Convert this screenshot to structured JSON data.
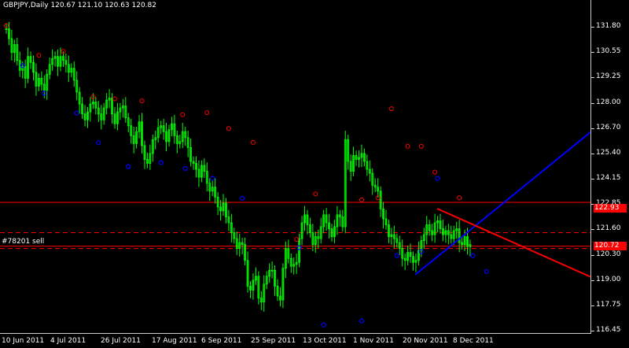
{
  "header": {
    "symbol_line": "GBPJPY,Daily  120.67 121.10 120.63 120.82"
  },
  "order_label": "#78201 sell",
  "level_labels": {
    "top": "122.93",
    "bottom": "120.72"
  },
  "colors": {
    "background": "#000000",
    "candle": "#00ff00",
    "fractal_high": "#ff0000",
    "fractal_low": "#0000ff",
    "level": "#ff0000",
    "trend_up": "#0000ff",
    "trend_down": "#ff0000"
  },
  "price_ticks": [
    "131.80",
    "130.55",
    "129.25",
    "128.00",
    "126.70",
    "125.40",
    "124.15",
    "122.85",
    "121.60",
    "120.30",
    "119.00",
    "117.75",
    "116.45"
  ],
  "time_ticks": [
    "10 Jun 2011",
    "4 Jul 2011",
    "26 Jul 2011",
    "17 Aug 2011",
    "6 Sep 2011",
    "25 Sep 2011",
    "13 Oct 2011",
    "1 Nov 2011",
    "20 Nov 2011",
    "8 Dec 2011"
  ],
  "chart_data": {
    "type": "candlestick",
    "symbol": "GBPJPY",
    "timeframe": "Daily",
    "ylim": [
      116.45,
      131.8
    ],
    "closes": [
      131.7,
      131.2,
      130.5,
      130.9,
      130.1,
      129.6,
      129.8,
      129.2,
      130.3,
      130.0,
      129.5,
      128.8,
      129.2,
      128.9,
      128.6,
      129.4,
      129.9,
      130.2,
      130.3,
      129.8,
      130.3,
      130.1,
      129.9,
      129.5,
      129.7,
      129.1,
      128.5,
      127.9,
      127.4,
      127.1,
      127.5,
      127.9,
      128.0,
      127.7,
      127.4,
      127.1,
      127.7,
      128.1,
      128.2,
      127.4,
      126.9,
      127.5,
      127.7,
      127.8,
      127.2,
      126.8,
      126.3,
      125.9,
      126.5,
      127.0,
      125.8,
      125.1,
      124.9,
      125.4,
      126.1,
      126.2,
      126.7,
      126.8,
      126.5,
      126.0,
      126.6,
      126.9,
      126.3,
      125.9,
      126.0,
      126.5,
      126.2,
      125.7,
      125.0,
      124.9,
      124.6,
      124.2,
      124.8,
      124.5,
      123.9,
      123.5,
      123.7,
      123.2,
      122.7,
      122.5,
      122.9,
      122.2,
      121.9,
      121.4,
      121.1,
      120.6,
      120.9,
      120.8,
      120.0,
      118.7,
      118.5,
      119.0,
      119.2,
      118.1,
      117.9,
      118.8,
      119.2,
      119.5,
      119.5,
      118.7,
      118.2,
      118.0,
      119.6,
      120.6,
      120.1,
      119.7,
      119.8,
      119.9,
      121.1,
      121.9,
      122.3,
      121.8,
      121.4,
      120.8,
      121.2,
      121.1,
      121.7,
      122.3,
      121.9,
      121.6,
      121.2,
      121.7,
      122.3,
      122.2,
      121.7,
      126.1,
      125.0,
      124.5,
      125.3,
      125.1,
      125.2,
      125.4,
      125.0,
      124.6,
      124.4,
      123.8,
      123.7,
      123.5,
      122.6,
      122.1,
      121.8,
      121.2,
      121.3,
      121.1,
      120.9,
      120.6,
      120.1,
      120.0,
      120.4,
      120.2,
      119.9,
      120.0,
      120.5,
      121.0,
      121.3,
      121.8,
      121.5,
      121.3,
      121.9,
      122.0,
      121.6,
      121.3,
      121.5,
      121.3,
      121.1,
      121.5,
      121.6,
      120.9,
      120.8,
      121.2,
      120.7,
      120.8
    ],
    "fractals_up": [
      [
        0,
        131.7
      ],
      [
        12,
        130.2
      ],
      [
        21,
        130.4
      ],
      [
        32,
        128.1
      ],
      [
        40,
        128.0
      ],
      [
        50,
        127.9
      ],
      [
        65,
        127.2
      ],
      [
        74,
        127.3
      ],
      [
        82,
        126.5
      ],
      [
        91,
        125.8
      ],
      [
        107,
        120.9
      ],
      [
        114,
        123.2
      ],
      [
        131,
        122.9
      ],
      [
        137,
        123.0
      ],
      [
        142,
        127.5
      ],
      [
        148,
        125.6
      ],
      [
        153,
        125.6
      ],
      [
        158,
        124.3
      ],
      [
        167,
        123.0
      ]
    ],
    "fractals_down": [
      [
        6,
        130.0
      ],
      [
        14,
        128.6
      ],
      [
        26,
        127.6
      ],
      [
        34,
        126.1
      ],
      [
        45,
        124.9
      ],
      [
        57,
        125.1
      ],
      [
        66,
        124.8
      ],
      [
        76,
        124.3
      ],
      [
        87,
        123.3
      ],
      [
        108,
        120.8
      ],
      [
        117,
        116.9
      ],
      [
        131,
        117.1
      ],
      [
        144,
        120.4
      ],
      [
        153,
        120.6
      ],
      [
        159,
        124.3
      ],
      [
        172,
        120.4
      ],
      [
        177,
        119.6
      ]
    ]
  }
}
